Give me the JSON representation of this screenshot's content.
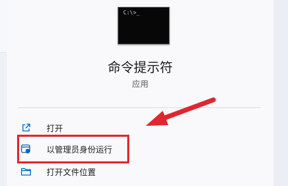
{
  "app": {
    "name": "命令提示符",
    "type": "应用",
    "icon": "cmd-terminal-icon",
    "prompt_glyph": "C:\\>_"
  },
  "actions": [
    {
      "label": "打开",
      "icon": "open-external-icon"
    },
    {
      "label": "以管理员身份运行",
      "icon": "admin-shield-icon"
    },
    {
      "label": "打开文件位置",
      "icon": "folder-icon"
    }
  ],
  "annotation": {
    "highlight_color": "#e0262f",
    "highlighted_action": "以管理员身份运行"
  },
  "colors": {
    "accent": "#0067c0",
    "panel_bg": "#f9f9fb",
    "annotation_red": "#e0262f"
  }
}
